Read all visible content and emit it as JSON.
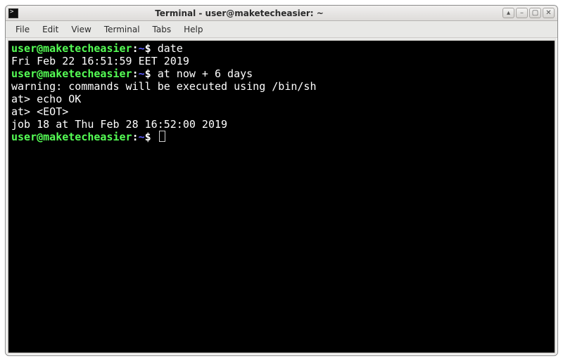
{
  "window": {
    "title": "Terminal - user@maketecheasier: ~"
  },
  "menu": {
    "items": [
      "File",
      "Edit",
      "View",
      "Terminal",
      "Tabs",
      "Help"
    ]
  },
  "window_buttons": {
    "up": "▴",
    "min": "–",
    "max": "▢",
    "close": "✕"
  },
  "prompt": {
    "user_host": "user@maketecheasier",
    "colon": ":",
    "path": "~",
    "symbol": "$"
  },
  "lines": [
    {
      "kind": "prompt",
      "cmd": "date"
    },
    {
      "kind": "output",
      "text": "Fri Feb 22 16:51:59 EET 2019"
    },
    {
      "kind": "prompt",
      "cmd": "at now + 6 days"
    },
    {
      "kind": "output",
      "text": "warning: commands will be executed using /bin/sh"
    },
    {
      "kind": "output",
      "text": "at> echo OK"
    },
    {
      "kind": "output",
      "text": "at> <EOT>"
    },
    {
      "kind": "output",
      "text": "job 18 at Thu Feb 28 16:52:00 2019"
    },
    {
      "kind": "prompt",
      "cmd": "",
      "cursor": true
    }
  ]
}
